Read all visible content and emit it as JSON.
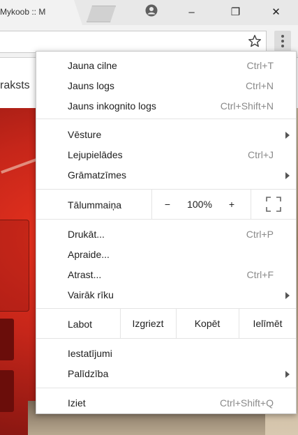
{
  "browser": {
    "tab_title": "Mykoob :: M",
    "tab_close": "×",
    "window_min": "–",
    "window_restore": "❐",
    "window_close": "✕"
  },
  "page": {
    "header_text": "raksts"
  },
  "menu": {
    "group1": [
      {
        "label": "Jauna cilne",
        "shortcut": "Ctrl+T"
      },
      {
        "label": "Jauns logs",
        "shortcut": "Ctrl+N"
      },
      {
        "label": "Jauns inkognito logs",
        "shortcut": "Ctrl+Shift+N"
      }
    ],
    "group2": [
      {
        "label": "Vēsture",
        "shortcut": ""
      },
      {
        "label": "Lejupielādes",
        "shortcut": "Ctrl+J"
      },
      {
        "label": "Grāmatzīmes",
        "shortcut": ""
      }
    ],
    "zoom": {
      "label": "Tālummaiņa",
      "minus": "−",
      "value": "100%",
      "plus": "+"
    },
    "group3": [
      {
        "label": "Drukāt...",
        "shortcut": "Ctrl+P"
      },
      {
        "label": "Apraide...",
        "shortcut": ""
      },
      {
        "label": "Atrast...",
        "shortcut": "Ctrl+F"
      },
      {
        "label": "Vairāk rīku",
        "shortcut": ""
      }
    ],
    "edit": {
      "label": "Labot",
      "cut": "Izgriezt",
      "copy": "Kopēt",
      "paste": "Ielīmēt"
    },
    "group4": [
      {
        "label": "Iestatījumi",
        "shortcut": ""
      },
      {
        "label": "Palīdzība",
        "shortcut": ""
      }
    ],
    "exit": {
      "label": "Iziet",
      "shortcut": "Ctrl+Shift+Q"
    }
  }
}
